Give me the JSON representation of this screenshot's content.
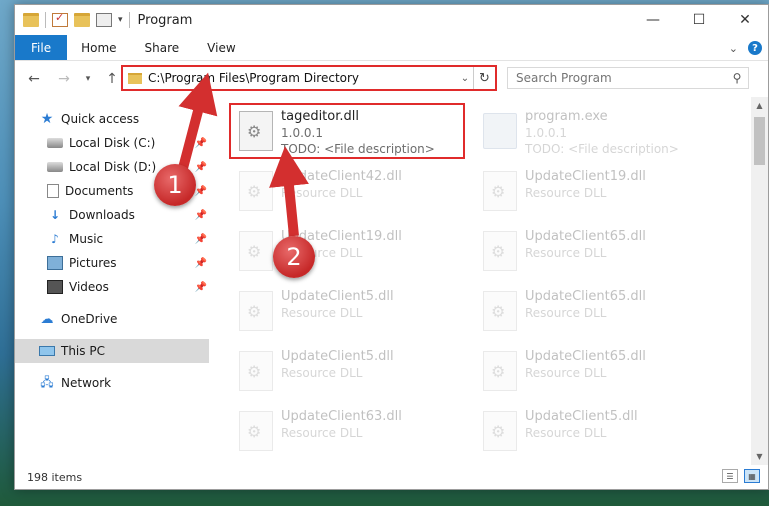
{
  "window": {
    "title": "Program",
    "controls": {
      "minimize": "—",
      "maximize": "☐",
      "close": "✕"
    }
  },
  "ribbon": {
    "tabs": [
      "File",
      "Home",
      "Share",
      "View"
    ]
  },
  "address": {
    "path": "C:\\Program Files\\Program Directory",
    "search_placeholder": "Search Program"
  },
  "nav": {
    "items": [
      {
        "label": "Quick access",
        "icon": "star-icon",
        "pinned": false
      },
      {
        "label": "Local Disk (C:)",
        "icon": "disk-icon",
        "pinned": true
      },
      {
        "label": "Local Disk (D:)",
        "icon": "disk-icon",
        "pinned": true
      },
      {
        "label": "Documents",
        "icon": "documents-icon",
        "pinned": true
      },
      {
        "label": "Downloads",
        "icon": "downloads-icon",
        "pinned": true
      },
      {
        "label": "Music",
        "icon": "music-icon",
        "pinned": true
      },
      {
        "label": "Pictures",
        "icon": "pictures-icon",
        "pinned": true
      },
      {
        "label": "Videos",
        "icon": "videos-icon",
        "pinned": true
      },
      {
        "label": "OneDrive",
        "icon": "onedrive-icon"
      },
      {
        "label": "This PC",
        "icon": "this-pc-icon",
        "selected": true
      },
      {
        "label": "Network",
        "icon": "network-icon"
      }
    ]
  },
  "files": [
    {
      "name": "tageditor.dll",
      "line1": "1.0.0.1",
      "line2": "TODO: <File description>",
      "highlighted": true
    },
    {
      "name": "program.exe",
      "line1": "1.0.0.1",
      "line2": "TODO: <File description>"
    },
    {
      "name": "UpdateClient42.dll",
      "line1": "Resource DLL"
    },
    {
      "name": "UpdateClient19.dll",
      "line1": "Resource DLL"
    },
    {
      "name": "UpdateClient19.dll",
      "line1": "Resource DLL"
    },
    {
      "name": "UpdateClient65.dll",
      "line1": "Resource DLL"
    },
    {
      "name": "UpdateClient5.dll",
      "line1": "Resource DLL"
    },
    {
      "name": "UpdateClient65.dll",
      "line1": "Resource DLL"
    },
    {
      "name": "UpdateClient5.dll",
      "line1": "Resource DLL"
    },
    {
      "name": "UpdateClient65.dll",
      "line1": "Resource DLL"
    },
    {
      "name": "UpdateClient63.dll",
      "line1": "Resource DLL"
    },
    {
      "name": "UpdateClient5.dll",
      "line1": "Resource DLL"
    }
  ],
  "status": {
    "count": "198 items"
  },
  "callouts": [
    "1",
    "2"
  ],
  "colors": {
    "accent": "#1979ca",
    "highlight": "#e02b2b",
    "callout": "#c62828"
  }
}
